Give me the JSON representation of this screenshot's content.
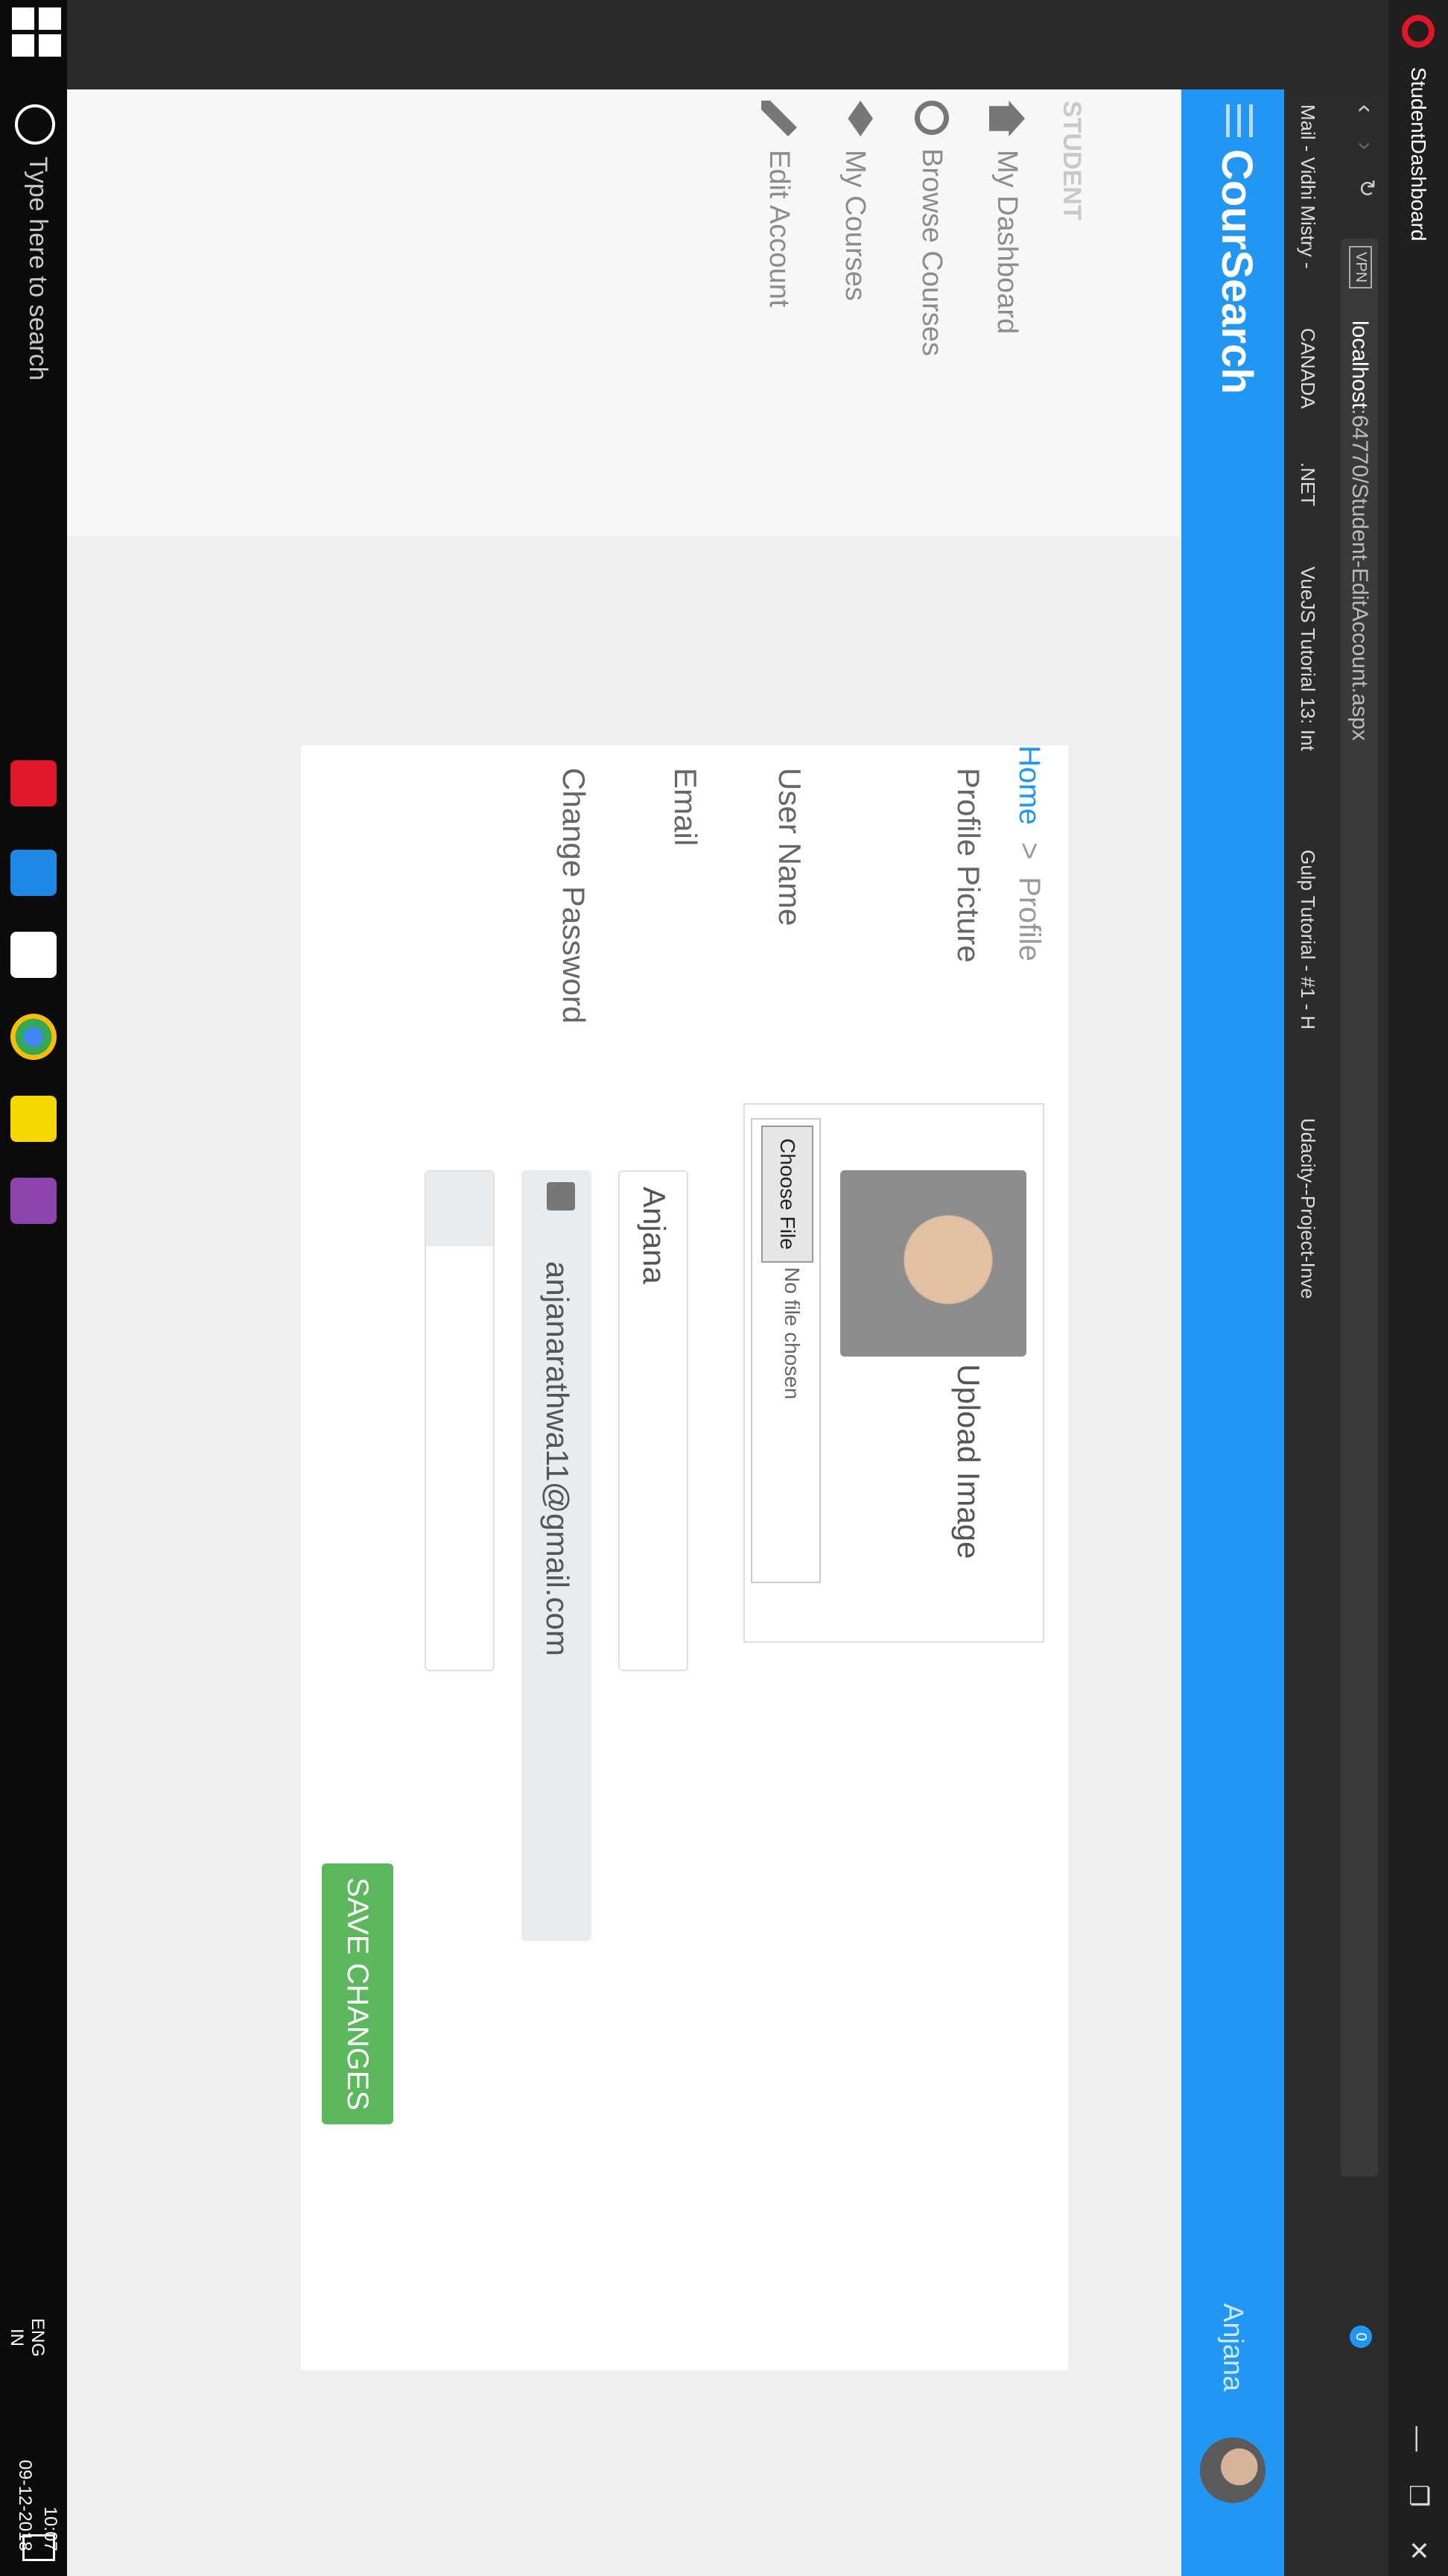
{
  "browser": {
    "tab_title": "StudentDashboard",
    "url_host": "localhost",
    "url_rest": ":64770/Student-EditAccount.aspx",
    "vpn_label": "VPN",
    "bookmarks": [
      "Mail - Vidhi Mistry - ",
      "CANADA",
      ".NET",
      "VueJS Tutorial 13: Int",
      "Gulp Tutorial - #1 - H",
      "Udacity--Project-Inve"
    ],
    "badge_count": "0"
  },
  "app": {
    "brand": "CourSearch",
    "user_name": "Anjana",
    "accent": "#2196f3"
  },
  "sidebar": {
    "heading": "STUDENT",
    "items": [
      {
        "label": "My Dashboard",
        "icon": "home-icon"
      },
      {
        "label": "Browse Courses",
        "icon": "search-icon"
      },
      {
        "label": "My Courses",
        "icon": "book-icon"
      },
      {
        "label": "Edit Account",
        "icon": "pencil-icon"
      }
    ]
  },
  "breadcrumb": {
    "home": "Home",
    "sep": ">",
    "current": "Profile"
  },
  "form": {
    "profile_picture_label": "Profile Picture",
    "upload_label": "Upload Image",
    "choose_file": "Choose File",
    "no_file": "No file chosen",
    "username_label": "User Name",
    "username_value": "Anjana",
    "email_label": "Email",
    "email_value": "anjanarathwa11@gmail.com",
    "change_password_label": "Change Password",
    "password_value": "",
    "save_button": "SAVE CHANGES",
    "save_color": "#5cb85c"
  },
  "taskbar": {
    "search_placeholder": "Type here to search",
    "lang_1": "ENG",
    "lang_2": "IN",
    "time": "10:07",
    "date": "09-12-2018"
  }
}
